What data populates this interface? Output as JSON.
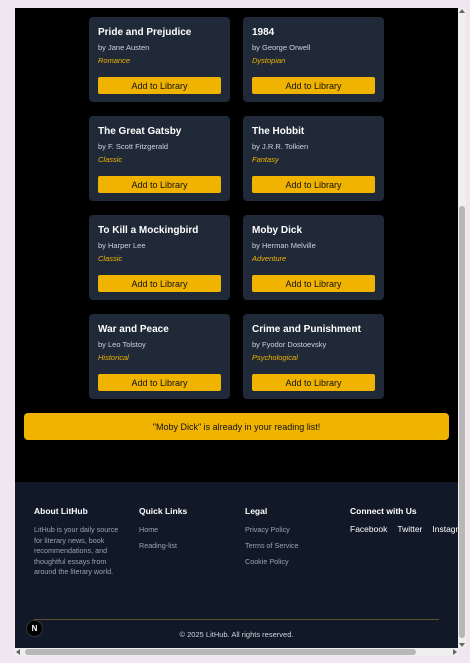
{
  "books": [
    {
      "title": "Pride and Prejudice",
      "author": "by Jane Austen",
      "genre": "Romance"
    },
    {
      "title": "1984",
      "author": "by George Orwell",
      "genre": "Dystopian"
    },
    {
      "title": "The Great Gatsby",
      "author": "by F. Scott Fitzgerald",
      "genre": "Classic"
    },
    {
      "title": "The Hobbit",
      "author": "by J.R.R. Tolkien",
      "genre": "Fantasy"
    },
    {
      "title": "To Kill a Mockingbird",
      "author": "by Harper Lee",
      "genre": "Classic"
    },
    {
      "title": "Moby Dick",
      "author": "by Herman Melville",
      "genre": "Adventure"
    },
    {
      "title": "War and Peace",
      "author": "by Leo Tolstoy",
      "genre": "Historical"
    },
    {
      "title": "Crime and Punishment",
      "author": "by Fyodor Dostoevsky",
      "genre": "Psychological"
    }
  ],
  "add_button_label": "Add to Library",
  "toast": "\"Moby Dick\" is already in your reading list!",
  "footer": {
    "about": {
      "heading": "About LitHub",
      "text": "LitHub is your daily source for literary news, book recommendations, and thoughtful essays from around the literary world."
    },
    "quick_links": {
      "heading": "Quick Links",
      "links": [
        "Home",
        "Reading-list"
      ]
    },
    "legal": {
      "heading": "Legal",
      "links": [
        "Privacy Policy",
        "Terms of Service",
        "Cookie Policy"
      ]
    },
    "connect": {
      "heading": "Connect with Us",
      "links": [
        "Facebook",
        "Twitter",
        "Instagram"
      ]
    },
    "copyright": "© 2025 LitHub. All rights reserved."
  },
  "badge_letter": "N",
  "colors": {
    "accent": "#f0b400",
    "card_bg": "#1f2937",
    "footer_bg": "#111827",
    "page_bg": "#000000"
  }
}
